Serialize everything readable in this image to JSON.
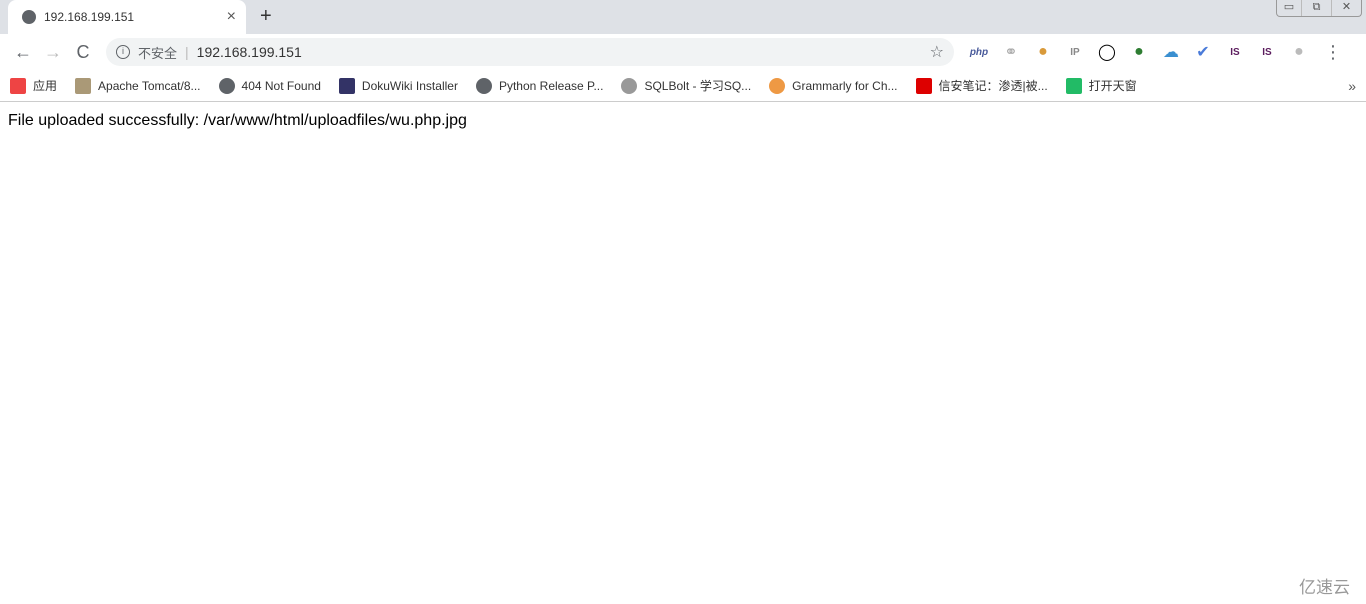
{
  "tab": {
    "title": "192.168.199.151",
    "close": "×",
    "new_tab": "+"
  },
  "window": {
    "minimize": "▭",
    "restore": "⧉",
    "close": "✕"
  },
  "toolbar": {
    "back": "←",
    "forward": "→",
    "reload": "C",
    "not_secure": "不安全",
    "separator": "|",
    "url": "192.168.199.151",
    "star": "☆",
    "menu": "⋮"
  },
  "extensions": [
    {
      "name": "php",
      "label": "php",
      "color": "#4a5b9b"
    },
    {
      "name": "link",
      "label": "⚭",
      "color": "#aaa"
    },
    {
      "name": "cookie",
      "label": "●",
      "color": "#d99a3a"
    },
    {
      "name": "ip",
      "label": "IP",
      "color": "#888"
    },
    {
      "name": "ring",
      "label": "◯",
      "color": "#000"
    },
    {
      "name": "green",
      "label": "●",
      "color": "#2e7d32"
    },
    {
      "name": "cloud",
      "label": "☁",
      "color": "#3a8fd0"
    },
    {
      "name": "bird",
      "label": "✔",
      "color": "#4a7bd9"
    },
    {
      "name": "s1",
      "label": "IS",
      "color": "#5b1c5e"
    },
    {
      "name": "s2",
      "label": "IS",
      "color": "#5b1c5e"
    },
    {
      "name": "profile",
      "label": "●",
      "color": "#bbb"
    }
  ],
  "bookmarks": [
    {
      "label": "应用",
      "color": "#e44"
    },
    {
      "label": "Apache Tomcat/8...",
      "color": "#a97"
    },
    {
      "label": "404 Not Found",
      "color": "#5f6368"
    },
    {
      "label": "DokuWiki Installer",
      "color": "#336"
    },
    {
      "label": "Python Release P...",
      "color": "#5f6368"
    },
    {
      "label": "SQLBolt - 学习SQ...",
      "color": "#999"
    },
    {
      "label": "Grammarly for Ch...",
      "color": "#e94"
    },
    {
      "label": "信安笔记：渗透|被...",
      "color": "#d00"
    },
    {
      "label": "打开天窗",
      "color": "#2b6"
    }
  ],
  "bookmarks_more": "»",
  "content": {
    "message": "File uploaded successfully: /var/www/html/uploadfiles/wu.php.jpg"
  },
  "watermark": "亿速云"
}
